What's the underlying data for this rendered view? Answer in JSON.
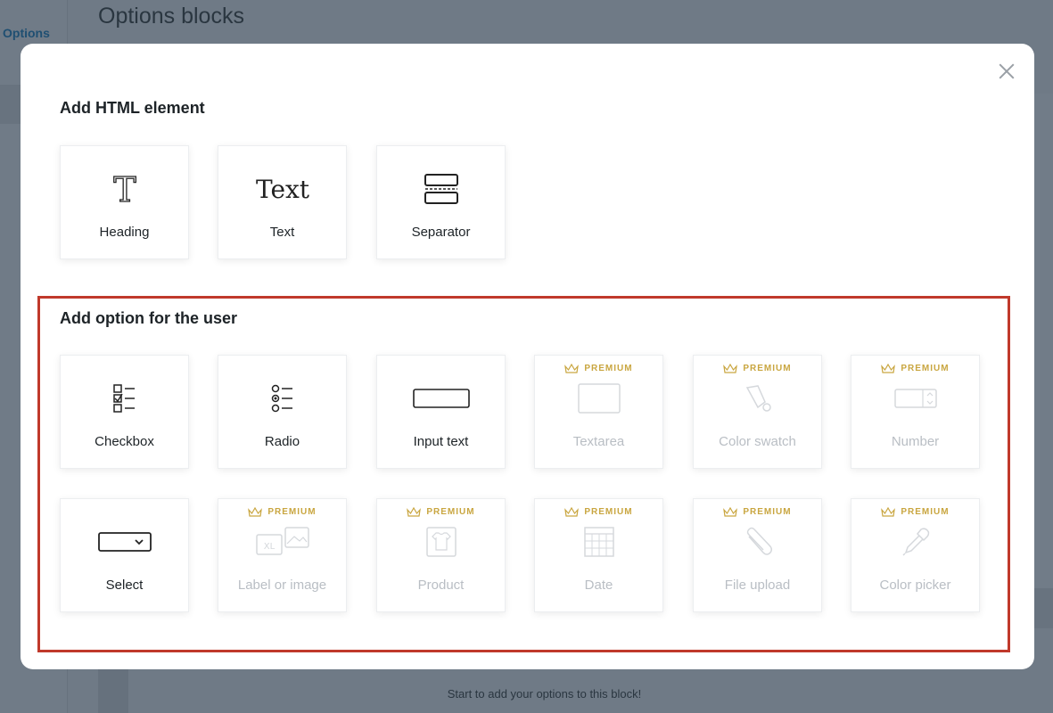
{
  "background": {
    "sidebar_link": "Options",
    "page_title": "Options blocks",
    "empty_message": "Start to add your options to this block!"
  },
  "modal": {
    "html_section": {
      "title": "Add HTML element",
      "items": [
        {
          "label": "Heading",
          "icon": "heading-icon",
          "premium": false
        },
        {
          "label": "Text",
          "icon": "text-icon",
          "premium": false
        },
        {
          "label": "Separator",
          "icon": "separator-icon",
          "premium": false
        }
      ]
    },
    "option_section": {
      "title": "Add option for the user",
      "premium_label": "PREMIUM",
      "items": [
        {
          "label": "Checkbox",
          "icon": "checkbox-icon",
          "premium": false
        },
        {
          "label": "Radio",
          "icon": "radio-icon",
          "premium": false
        },
        {
          "label": "Input text",
          "icon": "input-text-icon",
          "premium": false
        },
        {
          "label": "Textarea",
          "icon": "textarea-icon",
          "premium": true
        },
        {
          "label": "Color swatch",
          "icon": "color-swatch-icon",
          "premium": true
        },
        {
          "label": "Number",
          "icon": "number-icon",
          "premium": true
        },
        {
          "label": "Select",
          "icon": "select-icon",
          "premium": false
        },
        {
          "label": "Label or image",
          "icon": "label-image-icon",
          "premium": true
        },
        {
          "label": "Product",
          "icon": "product-icon",
          "premium": true
        },
        {
          "label": "Date",
          "icon": "date-icon",
          "premium": true
        },
        {
          "label": "File upload",
          "icon": "file-upload-icon",
          "premium": true
        },
        {
          "label": "Color picker",
          "icon": "color-picker-icon",
          "premium": true
        }
      ]
    }
  },
  "colors": {
    "highlight": "#c0392b",
    "premium": "#c9a640",
    "overlay": "#6f7a86"
  }
}
